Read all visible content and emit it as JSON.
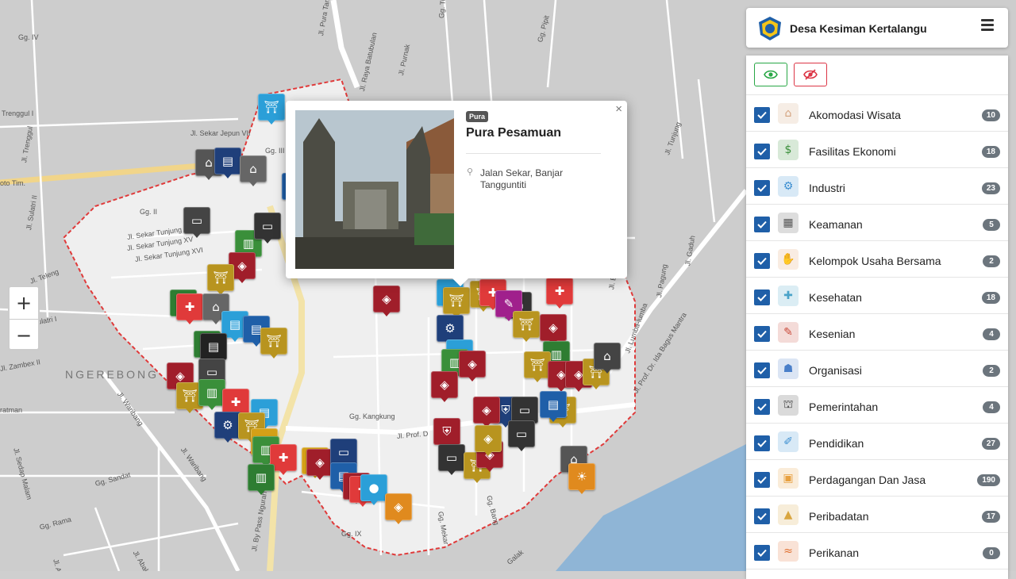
{
  "map": {
    "area_label": "NGEREBONG",
    "road_labels": [
      "Jl. Sekar Jepun VII",
      "Gg. IV",
      "Gg. III",
      "Trenggul I",
      "Jl. Trenggul",
      "oto Tim.",
      "Gg. II",
      "Jl. Sulatri II",
      "Jl. Teleng",
      "Jl. Sulatri I",
      "Jl. Sekar Tunjung XIV",
      "Jl. Sekar Tunjung XV",
      "Jl. Sekar Tunjung XVI",
      "Jl. Sekar Jepun",
      "Jl. Pura Tamu",
      "Jl. Raya Batubulan",
      "Jl. Purnak",
      "Gg. Pipit",
      "Gg. Tutur",
      "Jl. Tunjung",
      "Jl. Gaduh",
      "Jl. Prof. Dr. Ida Bagus Mantra",
      "Jl. Lumba-lumba",
      "Jl. Pagung",
      "Jl. Bima",
      "Gg. Kangkung",
      "Jl. Prof. D",
      "ratman",
      "Jl. Waribang",
      "Gg. Sandat",
      "Gg. Rama",
      "Jl. Zambex II",
      "Gg. Kenari",
      "Jl. By Pass Ngurah Rai",
      "Gg. Mekar",
      "Gg. Bang",
      "Jl. Akasia XV",
      "Jl. Sedap Malam",
      "Jl. Abaluan",
      "Gg. IX",
      "Galak"
    ],
    "zoom_in": "+",
    "zoom_out": "−"
  },
  "popup": {
    "category_badge": "Pura",
    "title": "Pura Pesamuan",
    "address": "Jalan Sekar, Banjar Tangguntiti",
    "close_symbol": "×"
  },
  "header": {
    "title": "Desa Kesiman Kertalangu"
  },
  "layers": [
    {
      "name": "Akomodasi Wisata",
      "count": "10",
      "icon": "hotel-icon",
      "color": "#d4a37f"
    },
    {
      "name": "Fasilitas Ekonomi",
      "count": "18",
      "icon": "money-icon",
      "color": "#3a8f3a"
    },
    {
      "name": "Industri",
      "count": "23",
      "icon": "factory-icon",
      "color": "#3d8fd1"
    },
    {
      "name": "Keamanan",
      "count": "5",
      "icon": "police-station-icon",
      "color": "#555555"
    },
    {
      "name": "Kelompok Usaha Bersama",
      "count": "2",
      "icon": "handshake-icon",
      "color": "#e0a070"
    },
    {
      "name": "Kesehatan",
      "count": "18",
      "icon": "hospital-icon",
      "color": "#4aa3c9"
    },
    {
      "name": "Kesenian",
      "count": "4",
      "icon": "art-icon",
      "color": "#c94a3a"
    },
    {
      "name": "Organisasi",
      "count": "2",
      "icon": "organization-icon",
      "color": "#4a7fc9"
    },
    {
      "name": "Pemerintahan",
      "count": "4",
      "icon": "government-icon",
      "color": "#444444"
    },
    {
      "name": "Pendidikan",
      "count": "27",
      "icon": "school-icon",
      "color": "#3d8fd1"
    },
    {
      "name": "Perdagangan Dan Jasa",
      "count": "190",
      "icon": "shopping-bag-icon",
      "color": "#e8a040"
    },
    {
      "name": "Peribadatan",
      "count": "17",
      "icon": "temple-icon",
      "color": "#d9a640"
    },
    {
      "name": "Perikanan",
      "count": "0",
      "icon": "fish-icon",
      "color": "#e07030"
    }
  ],
  "colors": {
    "checkbox": "#1f5fa8",
    "show_all": "#28a745",
    "hide_all": "#dc3545",
    "village_boundary": "#e03a3a",
    "sea": "#8fb5d6"
  }
}
